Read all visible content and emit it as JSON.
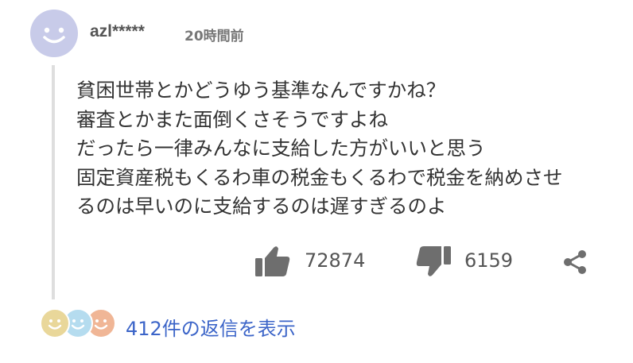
{
  "comment": {
    "username": "azl*****",
    "time": "20時間前",
    "lines": [
      "貧困世帯とかどうゆう基準なんですかね？",
      "審査とかまた面倒くさそうですよね",
      "だったら一律みんなに支給した方がいいと思う",
      "固定資産税もくるわ車の税金もくるわで税金を納めさせ",
      "るのは早いのに支給するのは遅すぎるのよ"
    ],
    "likes": "72874",
    "dislikes": "6159",
    "replies_label": "412件の返信を表示"
  },
  "icons": {
    "avatar": "smiley-face",
    "like": "thumbs-up-icon",
    "dislike": "thumbs-down-icon",
    "share": "share-icon"
  },
  "colors": {
    "avatar_main": "#c8cbe9",
    "reply_avatar_1": "#e9d79a",
    "reply_avatar_2": "#b5dcef",
    "reply_avatar_3": "#f0b696",
    "link": "#3b64c8",
    "icon": "#6e6e6e"
  }
}
